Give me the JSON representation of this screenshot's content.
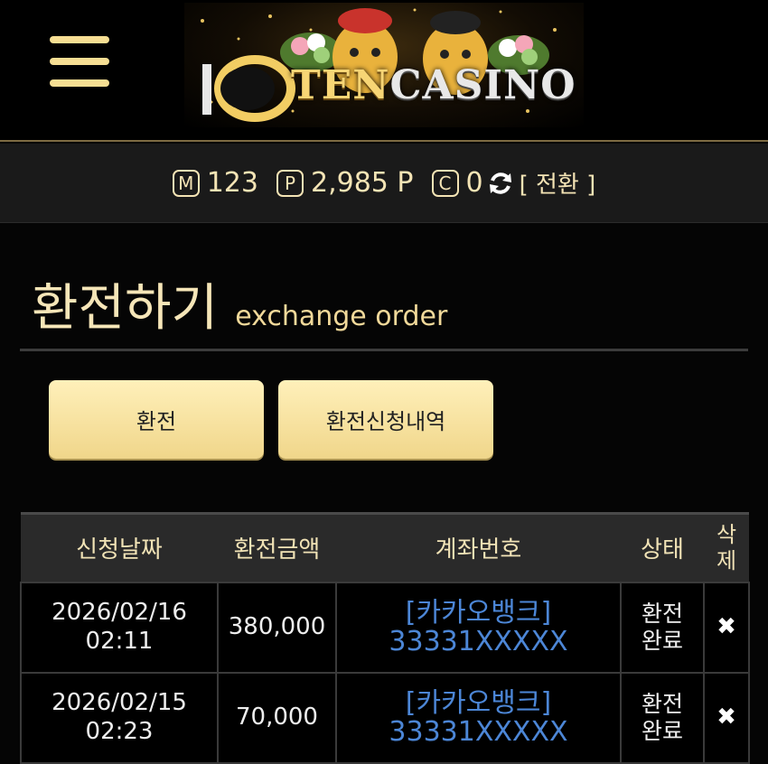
{
  "header": {
    "logo_text_1": "TEN",
    "logo_text_2": "CASINO",
    "brand_color": "#f6de93"
  },
  "points": {
    "money_icon": "M",
    "money_value": "123",
    "point_icon": "P",
    "point_value": "2,985 P",
    "coin_icon": "C",
    "coin_value": "0",
    "switch_label": "[ 전환 ]"
  },
  "page": {
    "title": "환전하기",
    "subtitle": "exchange order"
  },
  "tabs": [
    {
      "label": "환전"
    },
    {
      "label": "환전신청내역"
    }
  ],
  "table": {
    "headers": [
      "신청날짜",
      "환전금액",
      "계좌번호",
      "상태",
      "삭\n제"
    ],
    "rows": [
      {
        "date": "2026/02/16",
        "time": "02:11",
        "amount": "380,000",
        "bank": "[카카오뱅크]",
        "account": "33331XXXXX",
        "status_1": "환전",
        "status_2": "완료",
        "delete": "✖"
      },
      {
        "date": "2026/02/15",
        "time": "02:23",
        "amount": "70,000",
        "bank": "[카카오뱅크]",
        "account": "33331XXXXX",
        "status_1": "환전",
        "status_2": "완료",
        "delete": "✖"
      }
    ]
  }
}
